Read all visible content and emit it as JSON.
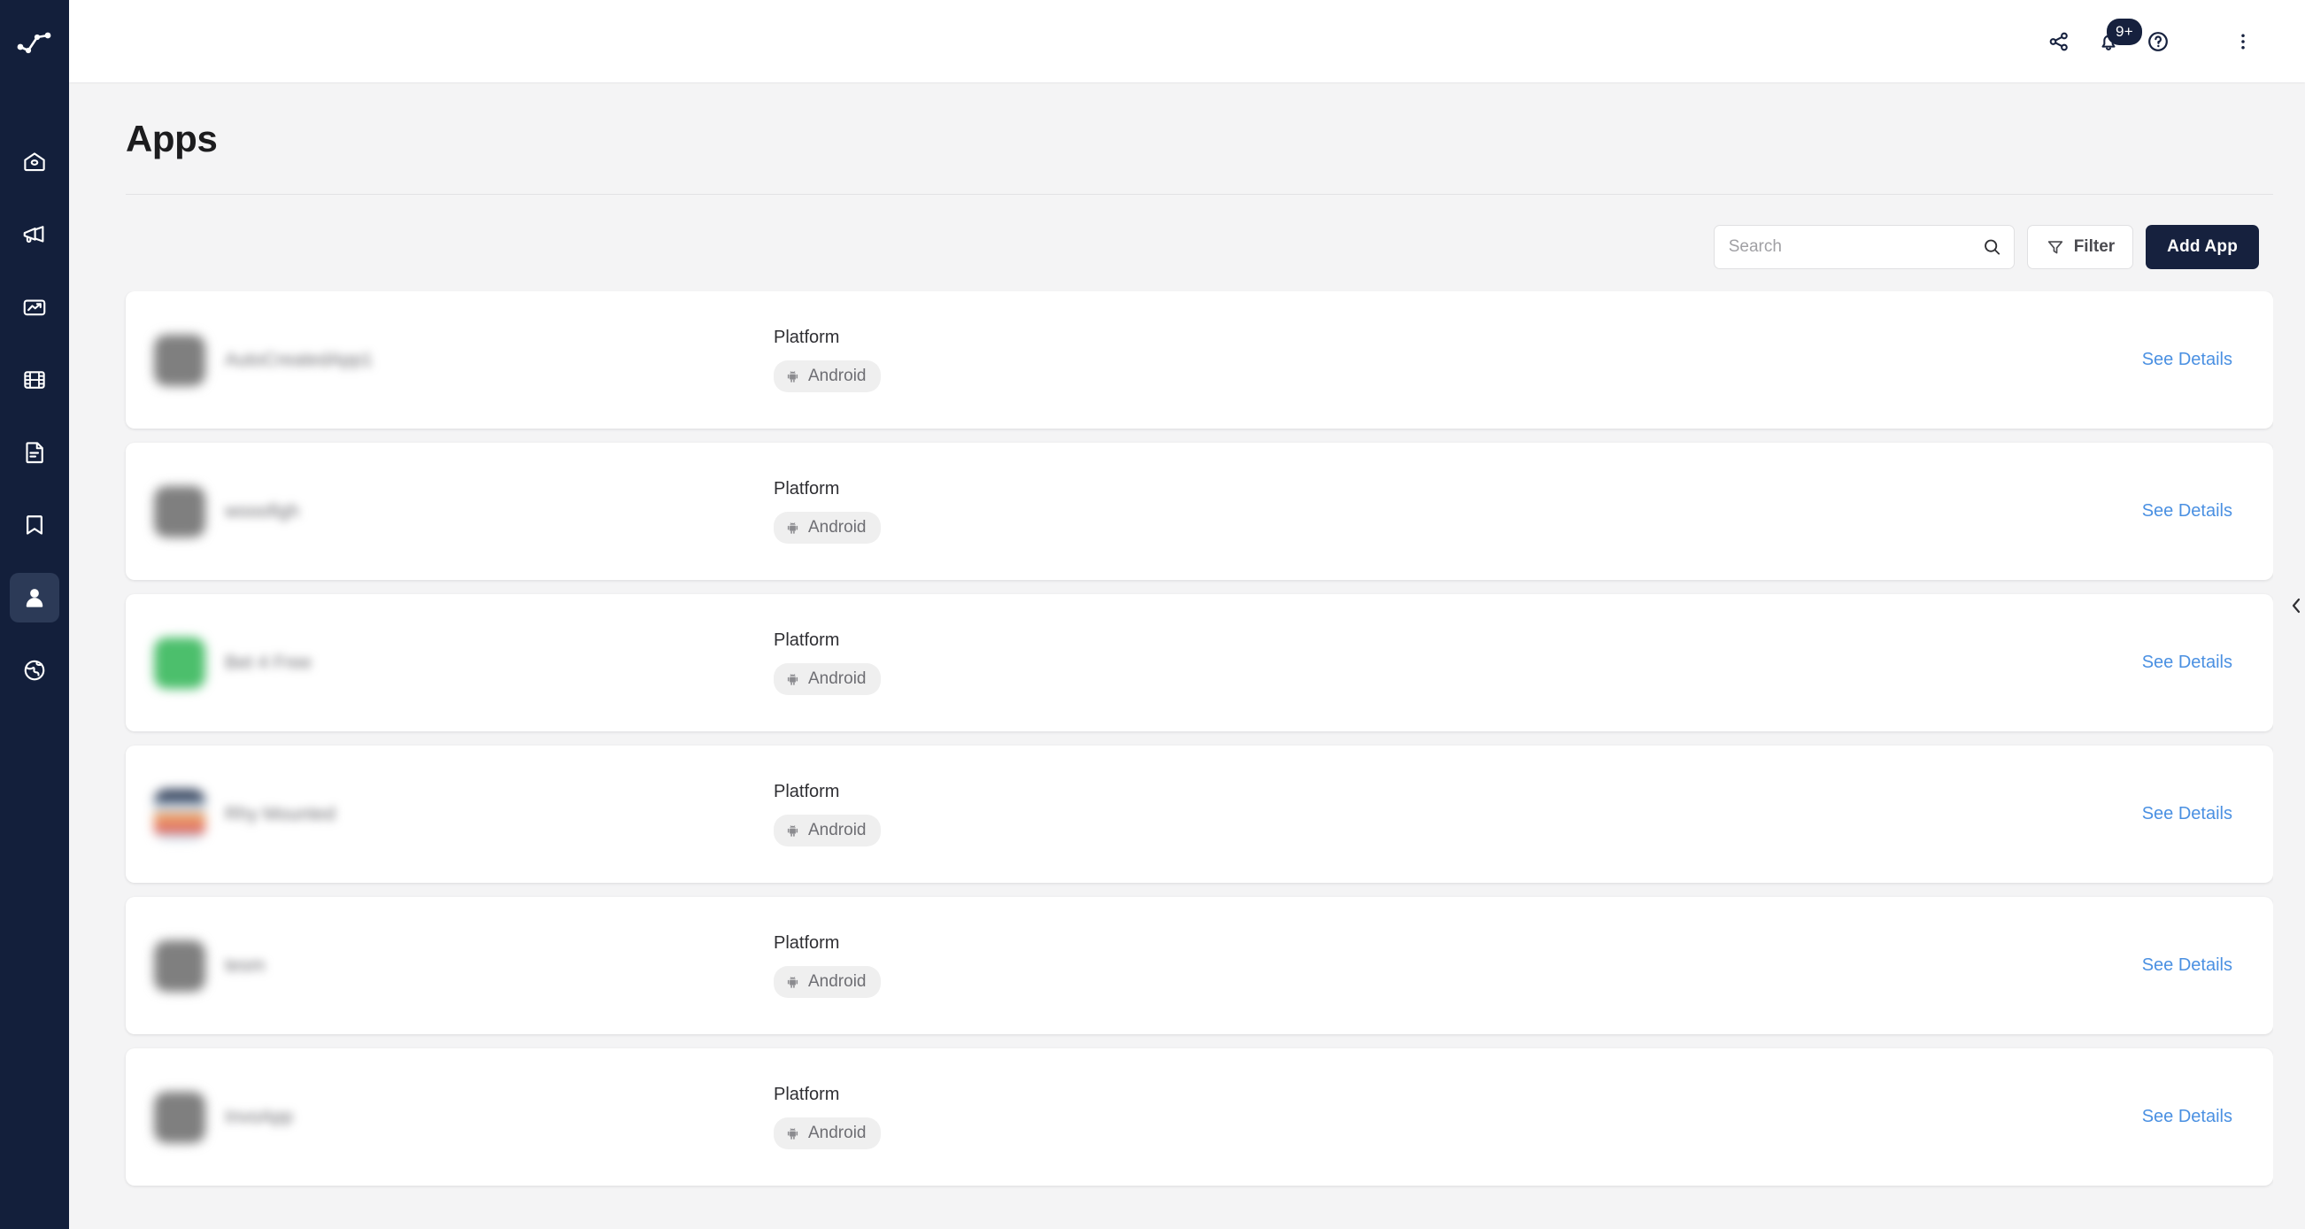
{
  "sidebar": {
    "logo": {
      "icon": "line-chart-logo-icon"
    },
    "items": [
      {
        "icon": "home-icon",
        "label": "Home",
        "active": false
      },
      {
        "icon": "megaphone-icon",
        "label": "Campaigns",
        "active": false
      },
      {
        "icon": "image-chart-icon",
        "label": "Creatives",
        "active": false
      },
      {
        "icon": "film-strip-icon",
        "label": "Media",
        "active": false
      },
      {
        "icon": "document-icon",
        "label": "Reports",
        "active": false
      },
      {
        "icon": "bookmark-icon",
        "label": "Saved",
        "active": false
      },
      {
        "icon": "person-icon",
        "label": "Apps",
        "active": true
      },
      {
        "icon": "globe-icon",
        "label": "Web",
        "active": false
      }
    ]
  },
  "topbar": {
    "share_icon": "share-icon",
    "notifications": {
      "icon": "bell-icon",
      "badge": "9+"
    },
    "help_icon": "help-circle-icon",
    "menu_icon": "kebab-menu-icon"
  },
  "page": {
    "title": "Apps"
  },
  "toolbar": {
    "search_placeholder": "Search",
    "search_value": "",
    "search_icon": "search-icon",
    "filter_label": "Filter",
    "filter_icon": "funnel-icon",
    "add_app_label": "Add App"
  },
  "collapse_handle": {
    "icon": "chevron-left-icon"
  },
  "labels": {
    "platform": "Platform",
    "see_details": "See Details"
  },
  "apps": [
    {
      "name": "AutoCreatedApp1",
      "icon_style": "dark",
      "platform": "Android",
      "platform_icon": "android-icon",
      "details_label": "See Details"
    },
    {
      "name": "wooofigh",
      "icon_style": "dark",
      "platform": "Android",
      "platform_icon": "android-icon",
      "details_label": "See Details"
    },
    {
      "name": "Bet 4 Free",
      "icon_style": "green",
      "platform": "Android",
      "platform_icon": "android-icon",
      "details_label": "See Details"
    },
    {
      "name": "Rhy Mounted",
      "icon_style": "multi",
      "platform": "Android",
      "platform_icon": "android-icon",
      "details_label": "See Details"
    },
    {
      "name": "tesm",
      "icon_style": "dark",
      "platform": "Android",
      "platform_icon": "android-icon",
      "details_label": "See Details"
    },
    {
      "name": "InvoApp",
      "icon_style": "dark",
      "platform": "Android",
      "platform_icon": "android-icon",
      "details_label": "See Details"
    }
  ]
}
